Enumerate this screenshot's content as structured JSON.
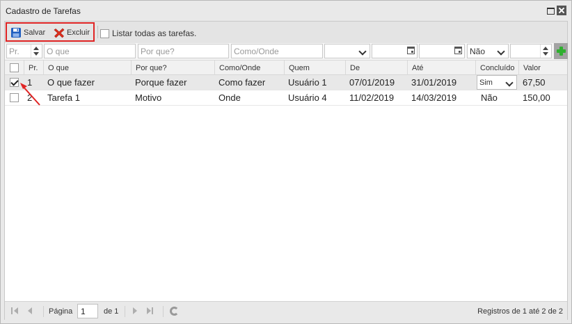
{
  "window": {
    "title": "Cadastro de Tarefas"
  },
  "toolbar": {
    "save_label": "Salvar",
    "delete_label": "Excluir",
    "list_all_label": "Listar todas as tarefas."
  },
  "filters": {
    "pr_placeholder": "Pr.",
    "oque_placeholder": "O que",
    "porque_placeholder": "Por que?",
    "comoonde_placeholder": "Como/Onde",
    "concluido_value": "Não"
  },
  "columns": [
    "Pr.",
    "O que",
    "Por que?",
    "Como/Onde",
    "Quem",
    "De",
    "Até",
    "Concluído",
    "Valor"
  ],
  "rows": [
    {
      "checked": true,
      "pr": "1",
      "oque": "O que fazer",
      "porque": "Porque fazer",
      "comoonde": "Como fazer",
      "quem": "Usuário 1",
      "de": "07/01/2019",
      "ate": "31/01/2019",
      "concluido": "Sim",
      "valor": "67,50"
    },
    {
      "checked": false,
      "pr": "2",
      "oque": "Tarefa 1",
      "porque": "Motivo",
      "comoonde": "Onde",
      "quem": "Usuário 4",
      "de": "11/02/2019",
      "ate": "14/03/2019",
      "concluido": "Não",
      "valor": "150,00"
    }
  ],
  "pager": {
    "page_label": "Página",
    "page_value": "1",
    "of_label": "de 1",
    "info": "Registros de 1 até 2 de 2"
  },
  "colors": {
    "highlight": "#e02424",
    "add": "#2faf2f",
    "save_icon": "#1f5fbf",
    "delete_icon": "#e0301e"
  }
}
